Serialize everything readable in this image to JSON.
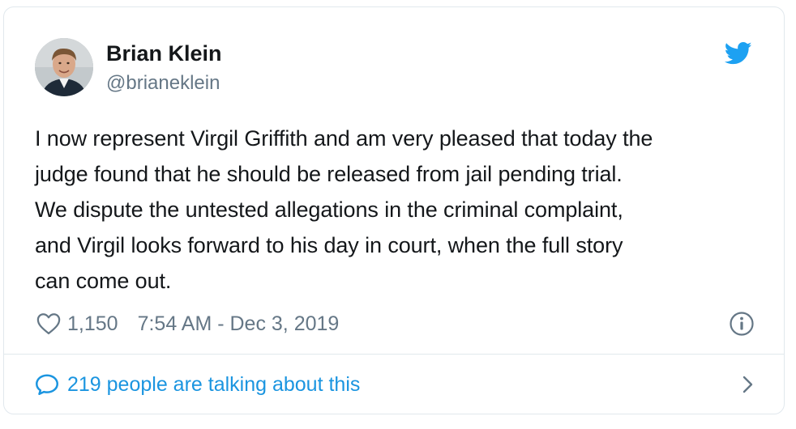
{
  "author": {
    "name": "Brian Klein",
    "handle": "@brianeklein"
  },
  "tweet": {
    "lines": [
      "I now represent Virgil Griffith and am very pleased that today the",
      "judge found that he should be released from jail pending trial.",
      "We dispute the untested allegations in the criminal complaint,",
      "and Virgil looks forward to his day in court, when the full story",
      "can come out."
    ]
  },
  "meta": {
    "likes": "1,150",
    "timestamp": "7:54 AM - Dec 3, 2019"
  },
  "footer": {
    "conversation_text": "219 people are talking about this"
  },
  "icons": {
    "logo": "twitter-bird-icon",
    "like": "heart-icon",
    "info": "info-icon",
    "conversation": "speech-bubble-icon",
    "more": "chevron-right-icon"
  },
  "colors": {
    "brand": "#1da1f2",
    "link": "#1b95e0",
    "secondary_text": "#657786",
    "primary_text": "#14171a",
    "border": "#e1e8ed"
  }
}
